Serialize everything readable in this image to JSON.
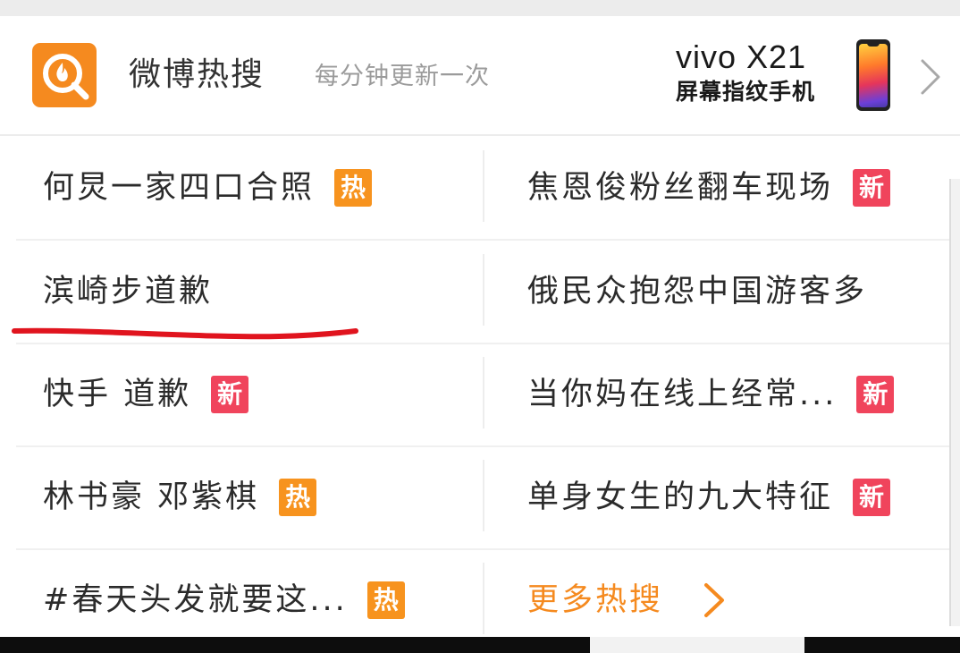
{
  "header": {
    "title": "微博热搜",
    "subtitle": "每分钟更新一次",
    "ad_brand": "vivo X21",
    "ad_tagline": "屏幕指纹手机"
  },
  "items": [
    {
      "left": {
        "text": "何炅一家四口合照",
        "badge": "热"
      },
      "right": {
        "text": "焦恩俊粉丝翻车现场",
        "badge": "新"
      }
    },
    {
      "left": {
        "text": "滨崎步道歉",
        "badge": ""
      },
      "right": {
        "text": "俄民众抱怨中国游客多",
        "badge": ""
      }
    },
    {
      "left": {
        "text": "快手 道歉",
        "badge": "新"
      },
      "right": {
        "text": "当你妈在线上经常...",
        "badge": "新"
      }
    },
    {
      "left": {
        "text": "林书豪 邓紫棋",
        "badge": "热"
      },
      "right": {
        "text": "单身女生的九大特征",
        "badge": "新"
      }
    },
    {
      "left": {
        "text": "#春天头发就要这...",
        "badge": "热"
      },
      "right": {
        "text": "更多热搜",
        "badge": ""
      }
    }
  ],
  "icons": {
    "logo": "weibo-hot-search-logo-icon",
    "header_chevron": "chevron-right-icon",
    "more_chevron": "chevron-right-icon"
  },
  "colors": {
    "accent_orange": "#f58a1f",
    "hot_badge": "#f7931e",
    "new_badge": "#f0445c",
    "annotation_underline": "#e0141e"
  }
}
